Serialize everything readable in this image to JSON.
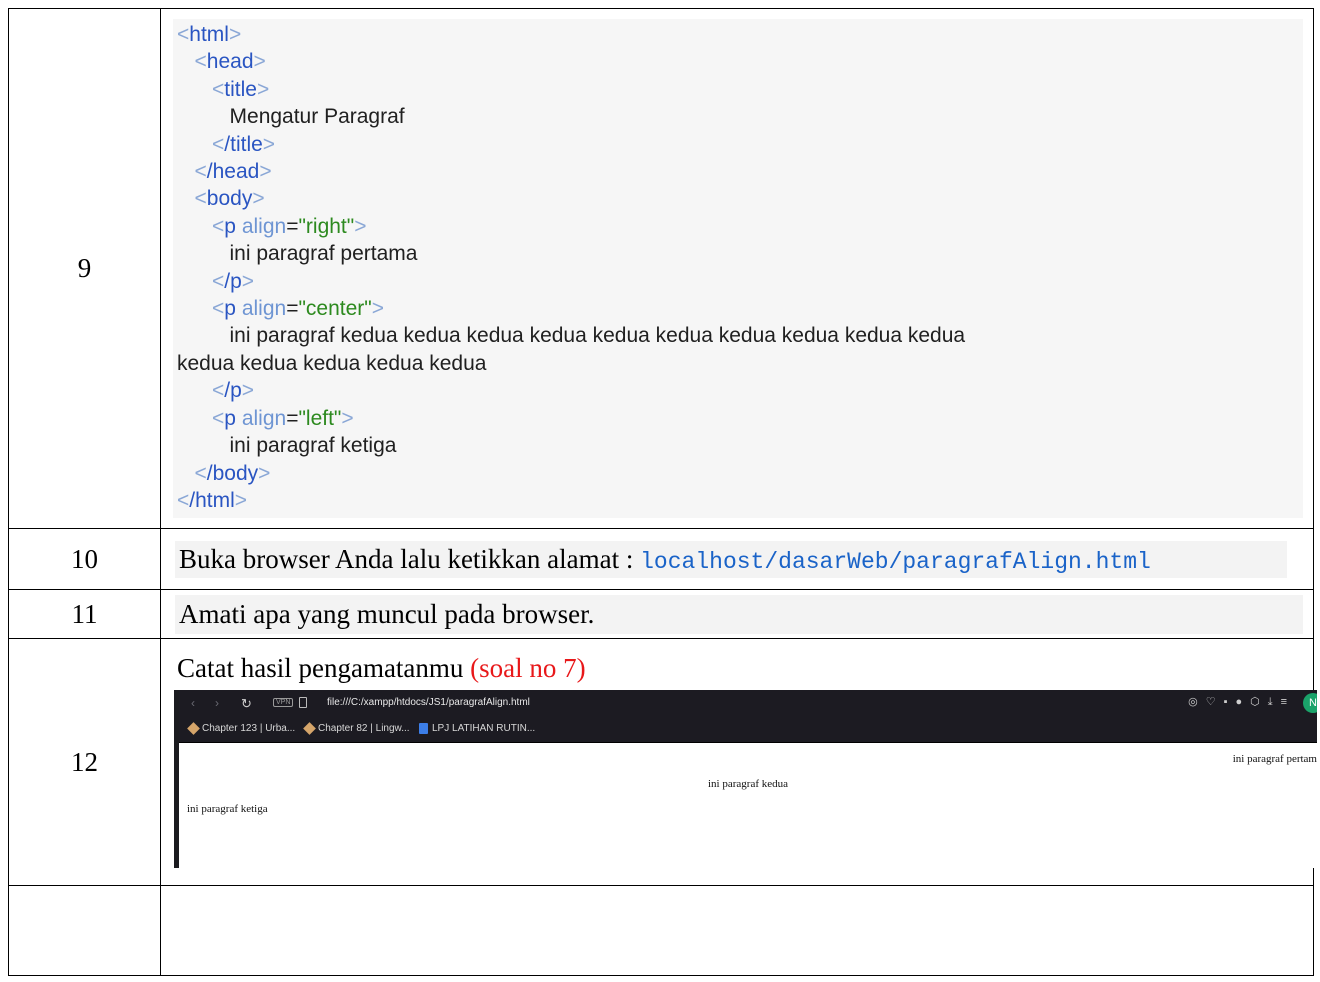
{
  "rows": {
    "r9": {
      "number": "9",
      "code": {
        "html_open": "html",
        "head_open": "head",
        "title_open": "title",
        "title_text": "Mengatur Paragraf",
        "title_close": "/title",
        "head_close": "/head",
        "body_open": "body",
        "p1_tag": "p",
        "p1_attr": "align",
        "p1_val": "\"right\"",
        "p1_text": "ini paragraf pertama",
        "p_close": "/p",
        "p2_tag": "p",
        "p2_attr": "align",
        "p2_val": "\"center\"",
        "p2_text_line1": "ini paragraf kedua kedua kedua kedua kedua kedua kedua kedua kedua kedua",
        "p2_text_line2": "kedua kedua kedua kedua kedua",
        "p3_tag": "p",
        "p3_attr": "align",
        "p3_val": "\"left\"",
        "p3_text": "ini paragraf ketiga",
        "body_close": "/body",
        "html_close": "/html"
      }
    },
    "r10": {
      "number": "10",
      "text": "Buka browser Anda lalu ketikkan alamat : ",
      "link": "localhost/dasarWeb/paragrafAlign.html"
    },
    "r11": {
      "number": "11",
      "text": "Amati apa yang muncul pada browser."
    },
    "r12": {
      "number": "12",
      "text": "Catat hasil pengamatanmu ",
      "highlight": "(soal no 7)",
      "screenshot": {
        "url": "file:///C:/xampp/htdocs/JS1/paragrafAlign.html",
        "vpn_label": "VPN",
        "avatar_letter": "N",
        "bookmarks": [
          "Chapter 123 | Urba...",
          "Chapter 82 | Lingw...",
          "LPJ LATIHAN RUTIN..."
        ],
        "p_right": "ini paragraf pertam",
        "p_center": "ini paragraf kedua",
        "p_left": "ini paragraf ketiga"
      }
    },
    "r13": {
      "number": ""
    }
  }
}
